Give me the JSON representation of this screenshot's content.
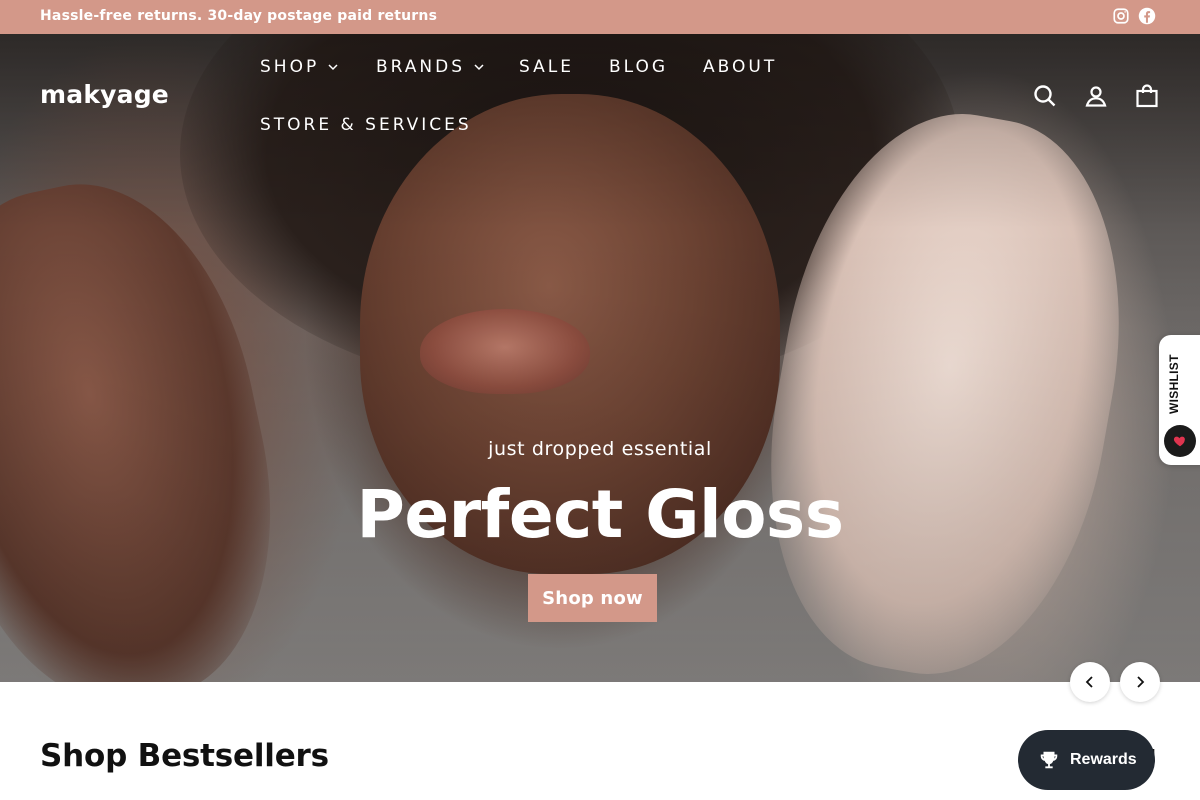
{
  "announcement": {
    "text": "Hassle-free returns. 30-day postage paid returns",
    "background": "#d39889"
  },
  "header": {
    "logo": "makyage",
    "nav": [
      {
        "label": "SHOP",
        "dropdown": true
      },
      {
        "label": "BRANDS",
        "dropdown": true
      },
      {
        "label": "SALE",
        "dropdown": false
      },
      {
        "label": "BLOG",
        "dropdown": false
      },
      {
        "label": "ABOUT",
        "dropdown": false
      },
      {
        "label": "STORE & SERVICES",
        "dropdown": false
      }
    ],
    "icons": [
      "search-icon",
      "account-icon",
      "cart-icon"
    ],
    "social_icons": [
      "instagram-icon",
      "facebook-icon"
    ]
  },
  "hero": {
    "kicker": "just dropped essential",
    "title": "Perfect Gloss",
    "button_label": "Shop now",
    "button_color": "#d39889"
  },
  "wishlist": {
    "label": "WISHLIST",
    "heart_color": "#e0344f"
  },
  "bestsellers": {
    "title": "Shop Bestsellers",
    "link_label": "!"
  },
  "rewards": {
    "label": "Rewards",
    "background": "#232a33"
  }
}
